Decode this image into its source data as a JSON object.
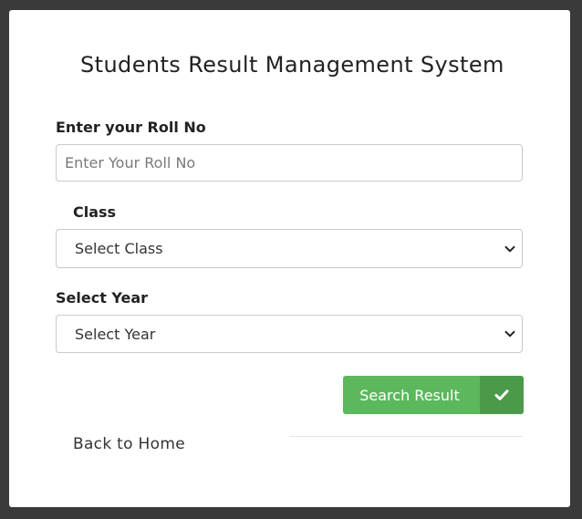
{
  "page": {
    "title": "Students Result Management System"
  },
  "form": {
    "roll_label": "Enter your Roll No",
    "roll_placeholder": "Enter Your Roll No",
    "roll_value": "",
    "class_label": "Class",
    "class_selected": "Select Class",
    "year_label": "Select Year",
    "year_selected": "Select Year",
    "submit_label": "Search Result",
    "submit_icon": "check-icon"
  },
  "footer": {
    "back_link": "Back to Home"
  },
  "colors": {
    "button_bg": "#5cb85c",
    "button_icon_bg": "#4a9a4a",
    "backdrop": "#3a3a3a"
  }
}
